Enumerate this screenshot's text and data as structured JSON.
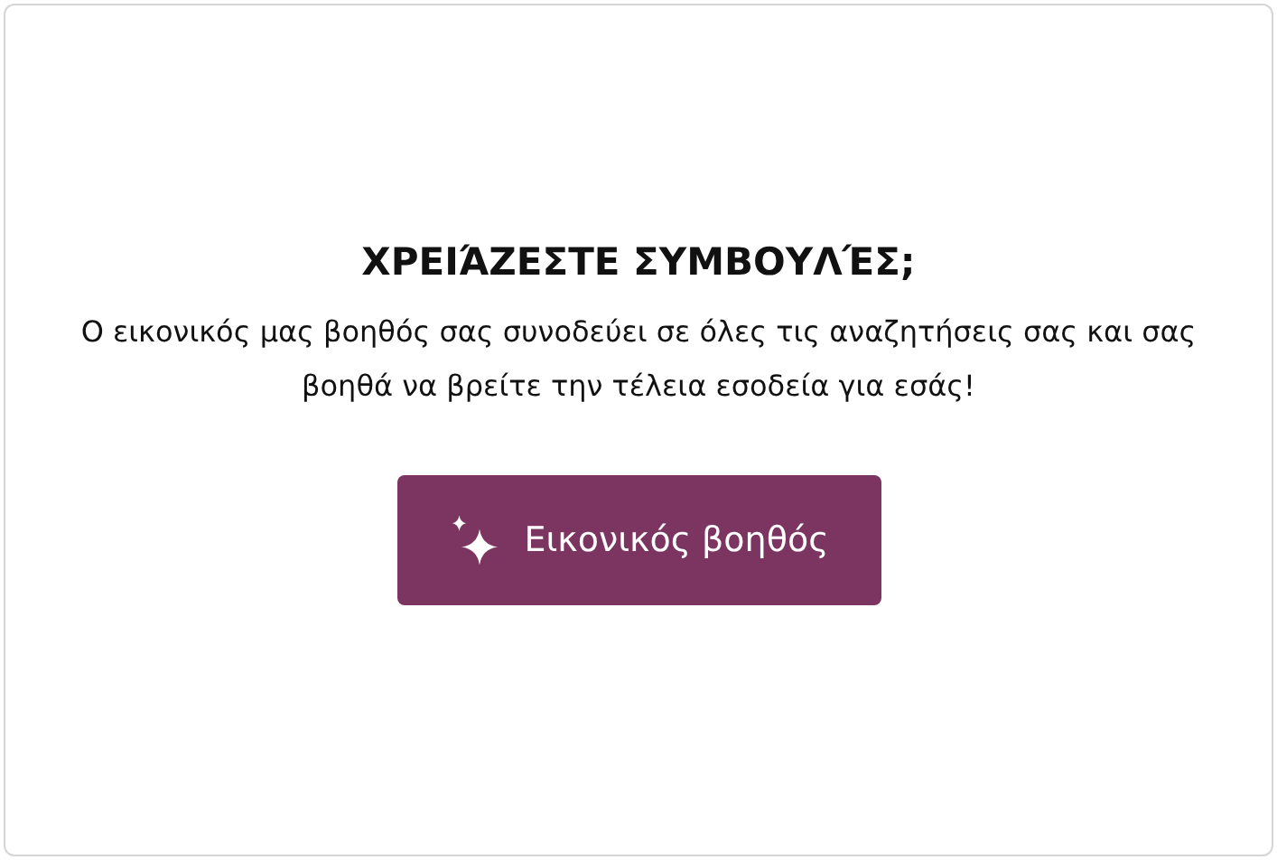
{
  "title": "ΧΡΕΙΆΖΕΣΤΕ ΣΥΜΒΟΥΛΈΣ;",
  "description": "Ο εικονικός μας βοηθός σας συνοδεύει σε όλες τις αναζητήσεις σας και σας βοηθά να βρείτε την τέλεια εσοδεία για εσάς!",
  "button": {
    "label": "Εικονικός βοηθός"
  }
}
